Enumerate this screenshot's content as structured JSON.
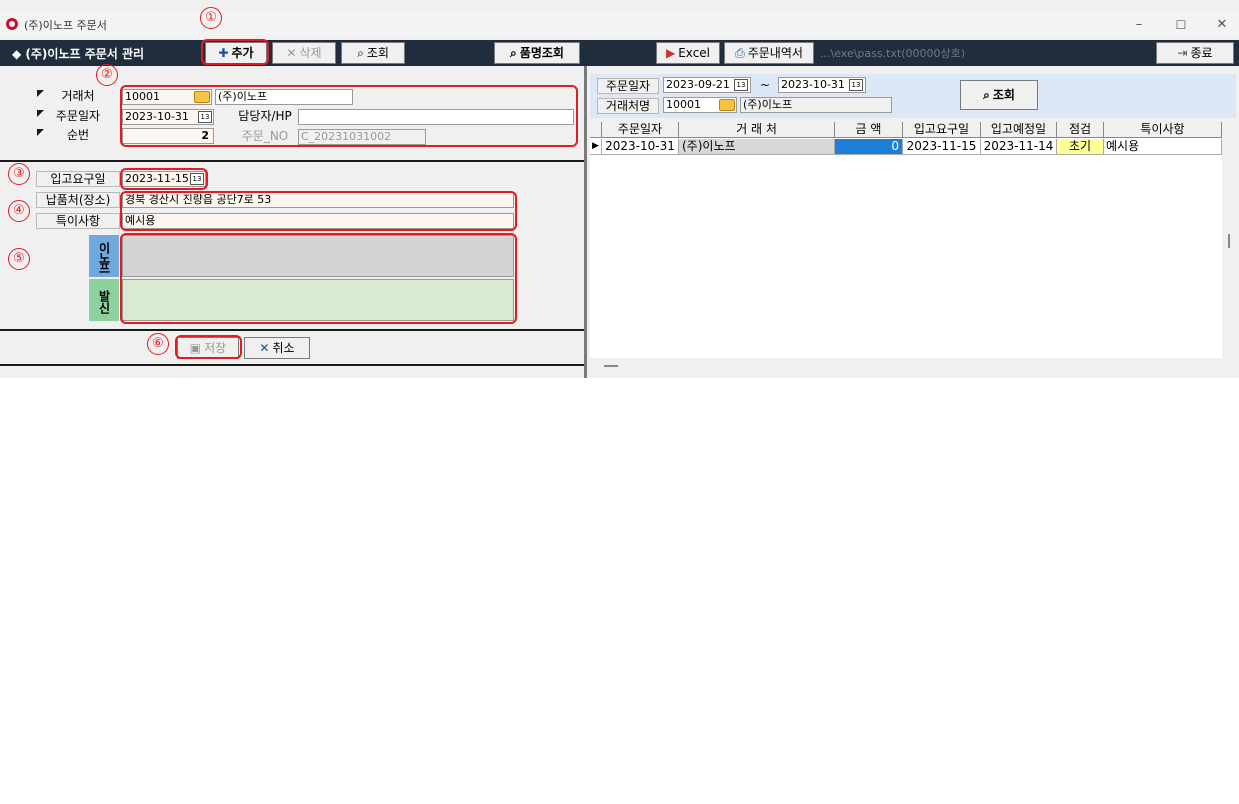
{
  "window": {
    "title": "(주)이노프 주문서",
    "minimize": "–",
    "maximize": "☐",
    "close": "✕"
  },
  "toolbar": {
    "section_title": "◆ (주)이노프 주문서 관리",
    "add_label": "추가",
    "delete_label": "삭제",
    "search_label": "조회",
    "item_search_label": "품명조회",
    "excel_label": "Excel",
    "order_history_label": "주문내역서",
    "path_text": "...\\exe\\pass.txt(00000상호)",
    "exit_label": "종료"
  },
  "annotations": [
    "①",
    "②",
    "③",
    "④",
    "⑤",
    "⑥"
  ],
  "form": {
    "client_label": "거래처",
    "client_code": "10001",
    "client_name": "(주)이노프",
    "order_date_label": "주문일자",
    "order_date": "2023-10-31",
    "manager_label": "담당자/HP",
    "manager_value": "",
    "seq_label": "순번",
    "seq_value": "2",
    "order_no_label": "주문_NO",
    "order_no_value": "C_20231031002",
    "arrival_date_label": "입고요구일",
    "arrival_date": "2023-11-15",
    "delivery_label": "납품처(장소)",
    "delivery_value": "경북 경산시 진량읍 공단7로 53",
    "notes_label": "특이사항",
    "notes_value": "예시용",
    "innof_tab": "이노프",
    "send_tab": "발신",
    "save_label": "저장",
    "cancel_label": "취소"
  },
  "filter": {
    "order_date_label": "주문일자",
    "date_from": "2023-09-21",
    "tilde": "~",
    "date_to": "2023-10-31",
    "client_label": "거래처명",
    "client_code": "10001",
    "client_name": "(주)이노프",
    "search_label": "조회"
  },
  "grid": {
    "columns": [
      "주문일자",
      "거 래 처",
      "금 액",
      "입고요구일",
      "입고예정일",
      "점검",
      "특이사항"
    ],
    "rows": [
      [
        "2023-10-31",
        "(주)이노프",
        "0",
        "2023-11-15",
        "2023-11-14",
        "초기",
        "예시용"
      ]
    ]
  },
  "colors": {
    "toolbar_bg": "#1f2d3d",
    "annotation_red": "#e31b23",
    "innof_tab_blue": "#6fa8dc",
    "send_tab_green": "#8fd19e",
    "amount_cell_blue": "#1e7fd8",
    "check_cell_yellow": "#ffff99"
  }
}
